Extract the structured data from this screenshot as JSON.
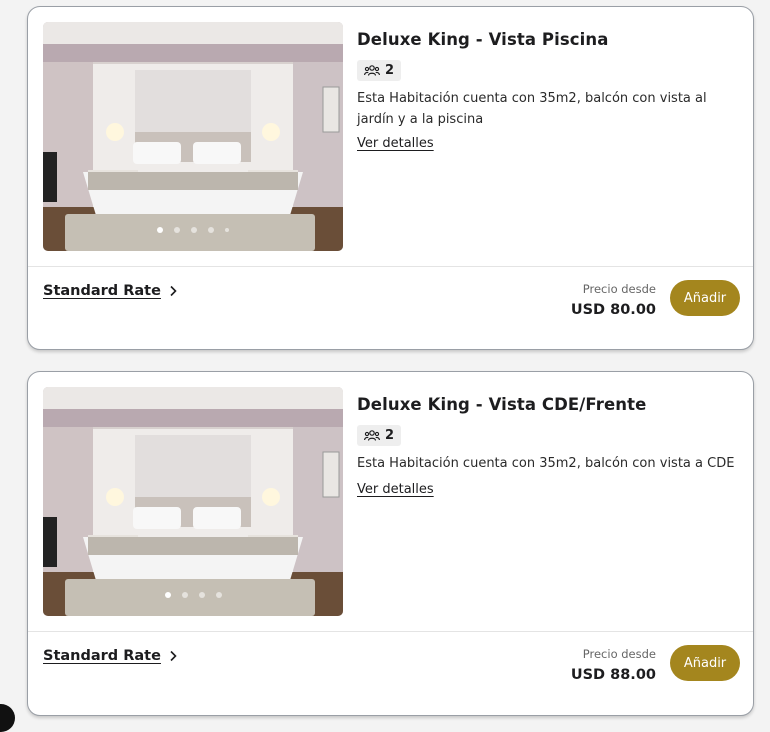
{
  "rooms": [
    {
      "title": "Deluxe King - Vista Piscina",
      "guests": "2",
      "description": "Esta Habitación cuenta con 35m2, balcón con vista al jardín y a la piscina",
      "details_label": "Ver detalles",
      "rate_label": "Standard Rate",
      "price_label": "Precio desde",
      "price": "USD 80.00",
      "add_label": "Añadir",
      "carousel_count": 5,
      "carousel_active": 1
    },
    {
      "title": "Deluxe King - Vista CDE/Frente",
      "guests": "2",
      "description": "Esta Habitación cuenta con 35m2, balcón con vista a CDE",
      "details_label": "Ver detalles",
      "rate_label": "Standard Rate",
      "price_label": "Precio desde",
      "price": "USD 88.00",
      "add_label": "Añadir",
      "carousel_count": 4,
      "carousel_active": 1
    }
  ],
  "icons": {
    "guests": "people-group-icon",
    "rate": "chevron-right-icon"
  },
  "colors": {
    "accent": "#a4861e",
    "border": "#9a9fa6",
    "background": "#f3f3f3"
  }
}
